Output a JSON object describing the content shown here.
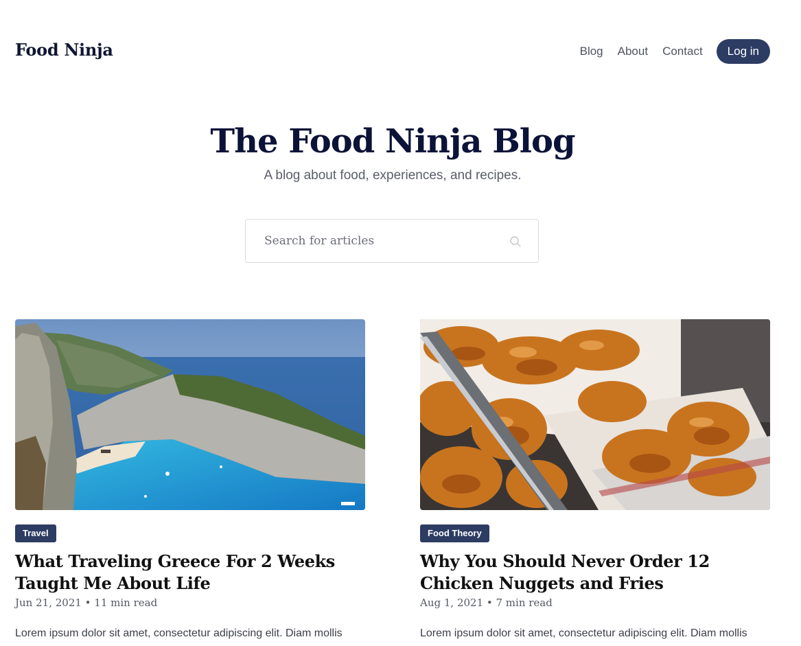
{
  "header": {
    "brand": "Food Ninja",
    "nav": [
      "Blog",
      "About",
      "Contact"
    ],
    "login_label": "Log in"
  },
  "hero": {
    "title": "The Food Ninja Blog",
    "subtitle": "A blog about food, experiences, and recipes."
  },
  "search": {
    "placeholder": "Search for articles",
    "icon": "search-icon"
  },
  "articles": [
    {
      "image": "greek-coast-bay-photo",
      "tag": "Travel",
      "title": "What Traveling Greece For 2 Weeks Taught Me About Life",
      "meta": "Jun 21, 2021 • 11 min read",
      "excerpt": "Lorem ipsum dolor sit amet, consectetur adipiscing elit. Diam mollis"
    },
    {
      "image": "fried-chicken-photo",
      "tag": "Food Theory",
      "title": "Why You Should Never Order 12 Chicken Nuggets and Fries",
      "meta": "Aug 1, 2021 • 7 min read",
      "excerpt": "Lorem ipsum dolor sit amet, consectetur adipiscing elit. Diam mollis"
    }
  ],
  "colors": {
    "primary": "#2d3c63",
    "heading": "#0c1338",
    "border": "#d9dbe0"
  }
}
